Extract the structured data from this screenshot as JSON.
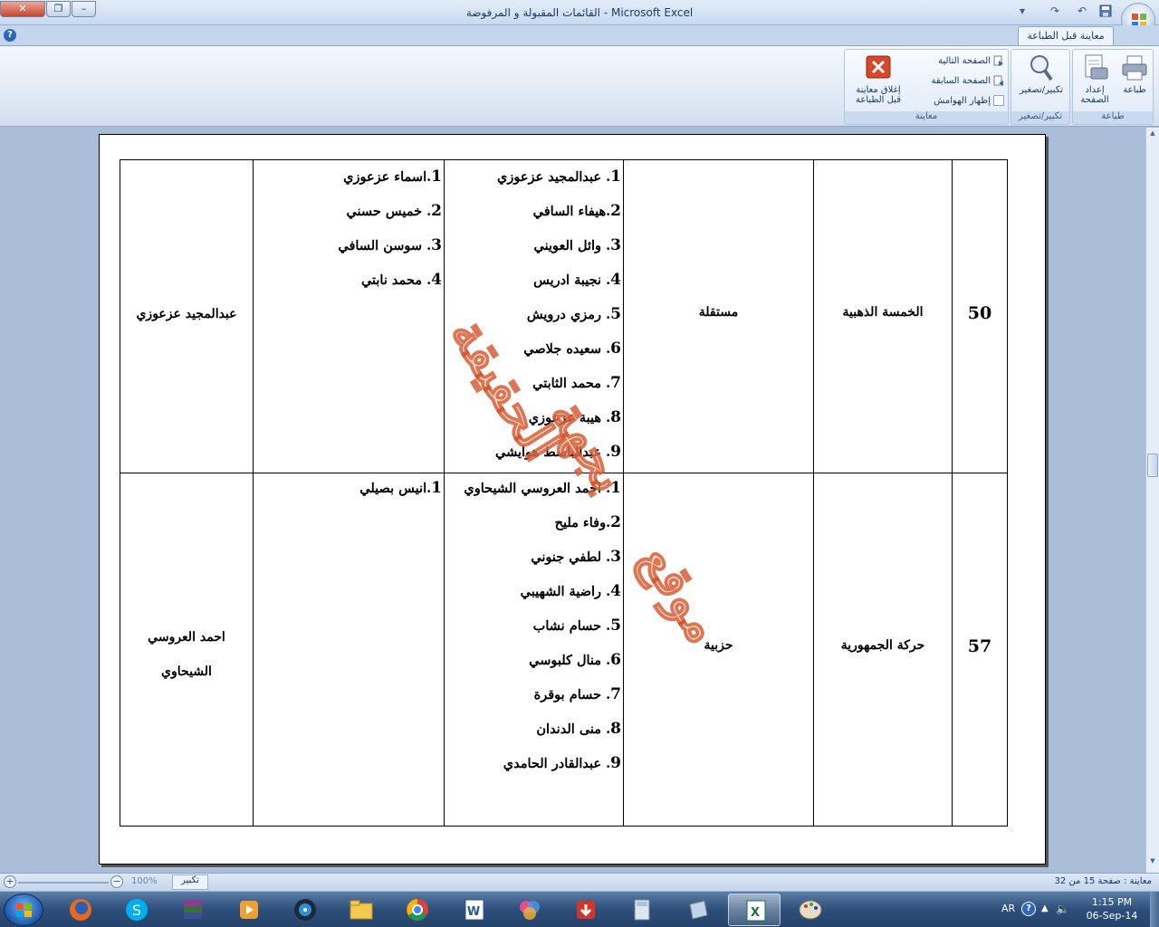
{
  "window": {
    "title": "القائمات المقبولة و المرفوضة - Microsoft Excel"
  },
  "ribbon": {
    "tab_label": "معاينة قبل الطباعة",
    "groups": {
      "print": {
        "label": "طباعة",
        "print_btn": "طباعة",
        "page_setup_btn": "إعداد الصفحة"
      },
      "zoom": {
        "label": "تكبير/تصغير",
        "zoom_btn": "تكبير/تصغير"
      },
      "preview": {
        "label": "معاينة",
        "next_page": "الصفحة التالية",
        "prev_page": "الصفحة السابقة",
        "show_margins": "إظهار الهوامش",
        "close_preview": "إغلاق معاينة قبل الطباعة"
      }
    }
  },
  "sheet": {
    "rows": [
      {
        "number": "50",
        "list_name": "الخمسة الذهبية",
        "type": "مستقلة",
        "candidates": [
          {
            "n": "1",
            "name": ". عبدالمجيد عزعوزي"
          },
          {
            "n": "2",
            "name": ".هيفاء السافي"
          },
          {
            "n": "3",
            "name": ". وائل العويني"
          },
          {
            "n": "4",
            "name": ". نجيبة ادريس"
          },
          {
            "n": "5",
            "name": ". رمزي درويش"
          },
          {
            "n": "6",
            "name": ". سعيده جلاصي"
          },
          {
            "n": "7",
            "name": ". محمد الثابتي"
          },
          {
            "n": "8",
            "name": ". هيبة عزعوزي"
          },
          {
            "n": "9",
            "name": ". عبدالباسط هوايشي"
          }
        ],
        "substitutes": [
          {
            "n": "1",
            "name": ".اسماء عزعوزي"
          },
          {
            "n": "2",
            "name": ". خميس حسني"
          },
          {
            "n": "3",
            "name": ". سوسن السافي"
          },
          {
            "n": "4",
            "name": ". محمد نابتي"
          }
        ],
        "head": "عبدالمجيد عزعوزي"
      },
      {
        "number": "57",
        "list_name": "حركة الجمهورية",
        "type": "حزبية",
        "candidates": [
          {
            "n": "1",
            "name": ". احمد العروسي الشيحاوي"
          },
          {
            "n": "2",
            "name": ".وفاء مليح"
          },
          {
            "n": "3",
            "name": ". لطفي جنوني"
          },
          {
            "n": "4",
            "name": ". راضية الشهيبي"
          },
          {
            "n": "5",
            "name": ". حسام نشاب"
          },
          {
            "n": "6",
            "name": ". منال كلبوسي"
          },
          {
            "n": "7",
            "name": ". حسام بوقرة"
          },
          {
            "n": "8",
            "name": ". منى الدندان"
          },
          {
            "n": "9",
            "name": ". عبدالقادر الحامدي"
          }
        ],
        "substitutes": [
          {
            "n": "1",
            "name": ".انيس بصيلي"
          }
        ],
        "head_line1": "احمد العروسي",
        "head_line2": "الشيحاوي"
      }
    ],
    "watermark": [
      "موقع",
      "الحقيقة",
      "بجهة"
    ]
  },
  "status": {
    "page_info": "معاينة : صفحة 15 من 32",
    "zoom_value": "100%",
    "zoom_label": "تكبير"
  },
  "taskbar": {
    "lang": "AR",
    "time": "1:15 PM",
    "date": "06-Sep-14"
  },
  "colors": {
    "accent": "#15396b",
    "close": "#c8452d",
    "watermark": "#d2502a"
  }
}
